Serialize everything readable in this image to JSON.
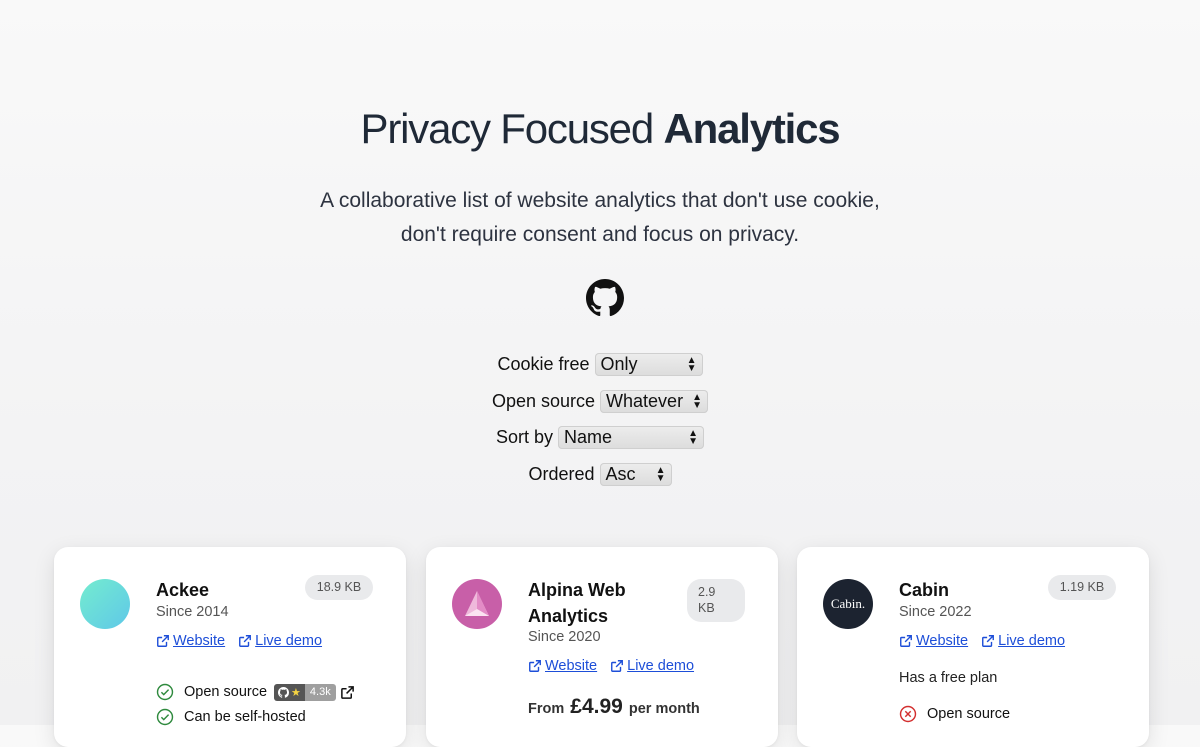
{
  "header": {
    "title_light": "Privacy Focused",
    "title_bold": "Analytics",
    "subtitle_line1": "A collaborative list of website analytics that don't use cookie,",
    "subtitle_line2": "don't require consent and focus on privacy.",
    "github_icon": "github-icon"
  },
  "filters": [
    {
      "label": "Cookie free",
      "value": "Only"
    },
    {
      "label": "Open source",
      "value": "Whatever"
    },
    {
      "label": "Sort by",
      "value": "Name"
    },
    {
      "label": "Ordered",
      "value": "Asc"
    }
  ],
  "cards": [
    {
      "name": "Ackee",
      "since": "Since 2014",
      "size": "18.9 KB",
      "website": "Website",
      "demo": "Live demo",
      "features": [
        "Open source",
        "Can be self-hosted"
      ],
      "stars": "4.3k",
      "logo_color": "#6ee0d0"
    },
    {
      "name_line1": "Alpina Web",
      "name_line2": "Analytics",
      "since": "Since 2020",
      "size_line1": "2.9",
      "size_line2": "KB",
      "website": "Website",
      "demo": "Live demo",
      "price_prefix": "From",
      "price": "£4.99",
      "price_suffix": "per month",
      "logo_color": "#c85fa8"
    },
    {
      "name": "Cabin",
      "since": "Since 2022",
      "size": "1.19 KB",
      "website": "Website",
      "demo": "Live demo",
      "plan": "Has a free plan",
      "features": [
        "Open source"
      ],
      "logo_text": "Cabin.",
      "logo_color": "#1c2330"
    }
  ]
}
